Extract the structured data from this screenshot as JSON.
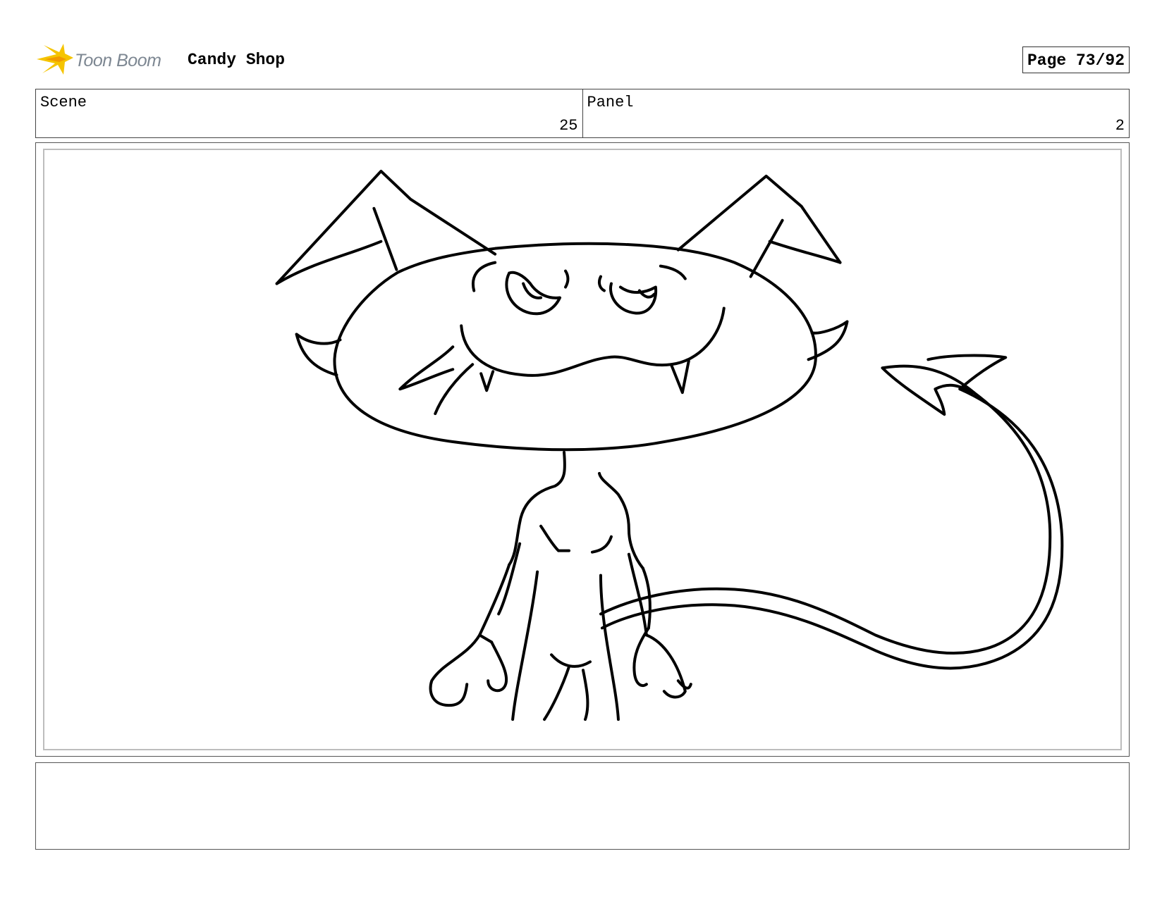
{
  "header": {
    "logo_text": "Toon Boom",
    "project_title": "Candy Shop",
    "page_label": "Page 73/92"
  },
  "info": {
    "scene_label": "Scene",
    "scene_value": "25",
    "panel_label": "Panel",
    "panel_value": "2"
  },
  "panel": {
    "drawing_icon": "devil-cat-sketch"
  },
  "notes": {
    "text": ""
  },
  "colors": {
    "logo_yellow": "#f5c400",
    "logo_orange": "#f29a00",
    "logo_text_gray": "#7d8792"
  }
}
